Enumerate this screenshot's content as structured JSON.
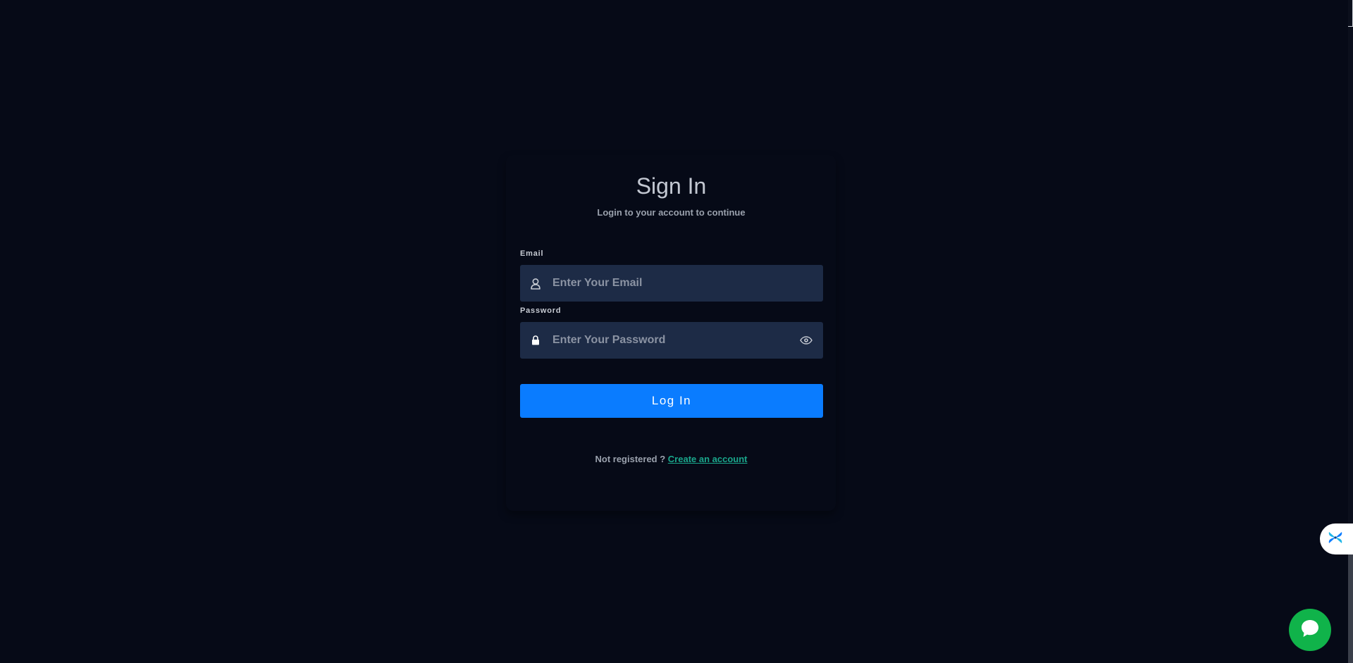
{
  "signin": {
    "title": "Sign In",
    "subtitle": "Login to your account to continue",
    "email_label": "Email",
    "email_placeholder": "Enter Your Email",
    "email_value": "",
    "password_label": "Password",
    "password_placeholder": "Enter Your Password",
    "password_value": "",
    "login_label": "Log In",
    "not_registered": "Not registered ?",
    "create_account": "Create an account"
  },
  "icons": {
    "email": "user-icon",
    "password": "lock-icon",
    "password_toggle": "eye-icon",
    "side_widget": "pinwheel-icon",
    "chat": "chat-bubble-icon"
  },
  "colors": {
    "background": "#060a17",
    "input_bg": "#1d2b46",
    "primary": "#0a7cff",
    "link": "#1aa78c",
    "chat": "#10b34a"
  }
}
